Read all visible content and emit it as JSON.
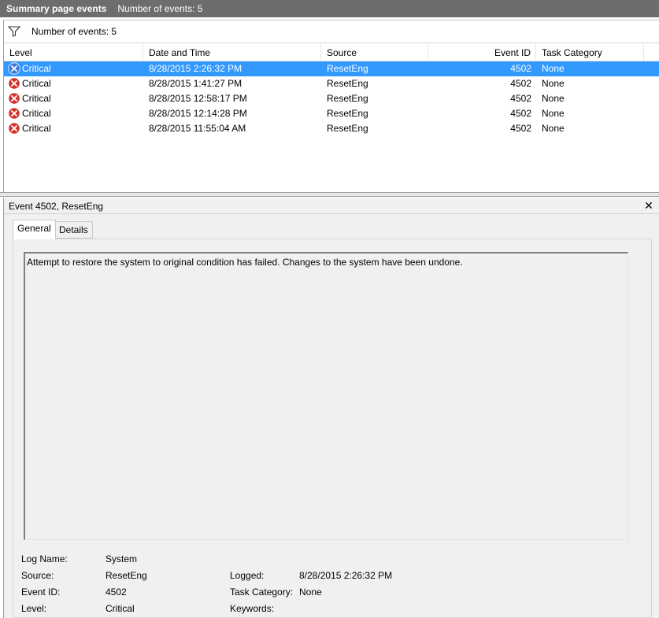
{
  "titlebar": {
    "title": "Summary page events",
    "count_text": "Number of events: 5"
  },
  "filter": {
    "icon": "filter-icon",
    "text": "Number of events: 5"
  },
  "grid": {
    "columns": [
      "Level",
      "Date and Time",
      "Source",
      "Event ID",
      "Task Category"
    ],
    "rows": [
      {
        "level": "Critical",
        "datetime": "8/28/2015 2:26:32 PM",
        "source": "ResetEng",
        "event_id": "4502",
        "category": "None",
        "selected": true
      },
      {
        "level": "Critical",
        "datetime": "8/28/2015 1:41:27 PM",
        "source": "ResetEng",
        "event_id": "4502",
        "category": "None",
        "selected": false
      },
      {
        "level": "Critical",
        "datetime": "8/28/2015 12:58:17 PM",
        "source": "ResetEng",
        "event_id": "4502",
        "category": "None",
        "selected": false
      },
      {
        "level": "Critical",
        "datetime": "8/28/2015 12:14:28 PM",
        "source": "ResetEng",
        "event_id": "4502",
        "category": "None",
        "selected": false
      },
      {
        "level": "Critical",
        "datetime": "8/28/2015 11:55:04 AM",
        "source": "ResetEng",
        "event_id": "4502",
        "category": "None",
        "selected": false
      }
    ]
  },
  "detail": {
    "title": "Event 4502, ResetEng",
    "close_label": "✕",
    "tabs": {
      "general": "General",
      "details": "Details"
    },
    "message": "Attempt to restore the system to original condition has failed. Changes to the system have been undone.",
    "props": {
      "log_name_label": "Log Name:",
      "log_name_value": "System",
      "source_label": "Source:",
      "source_value": "ResetEng",
      "logged_label": "Logged:",
      "logged_value": "8/28/2015 2:26:32 PM",
      "event_id_label": "Event ID:",
      "event_id_value": "4502",
      "task_category_label": "Task Category:",
      "task_category_value": "None",
      "level_label": "Level:",
      "level_value": "Critical",
      "keywords_label": "Keywords:"
    }
  },
  "colors": {
    "selection": "#3399ff",
    "critical_icon": "#d0342c",
    "titlebar": "#6d6d6d"
  }
}
